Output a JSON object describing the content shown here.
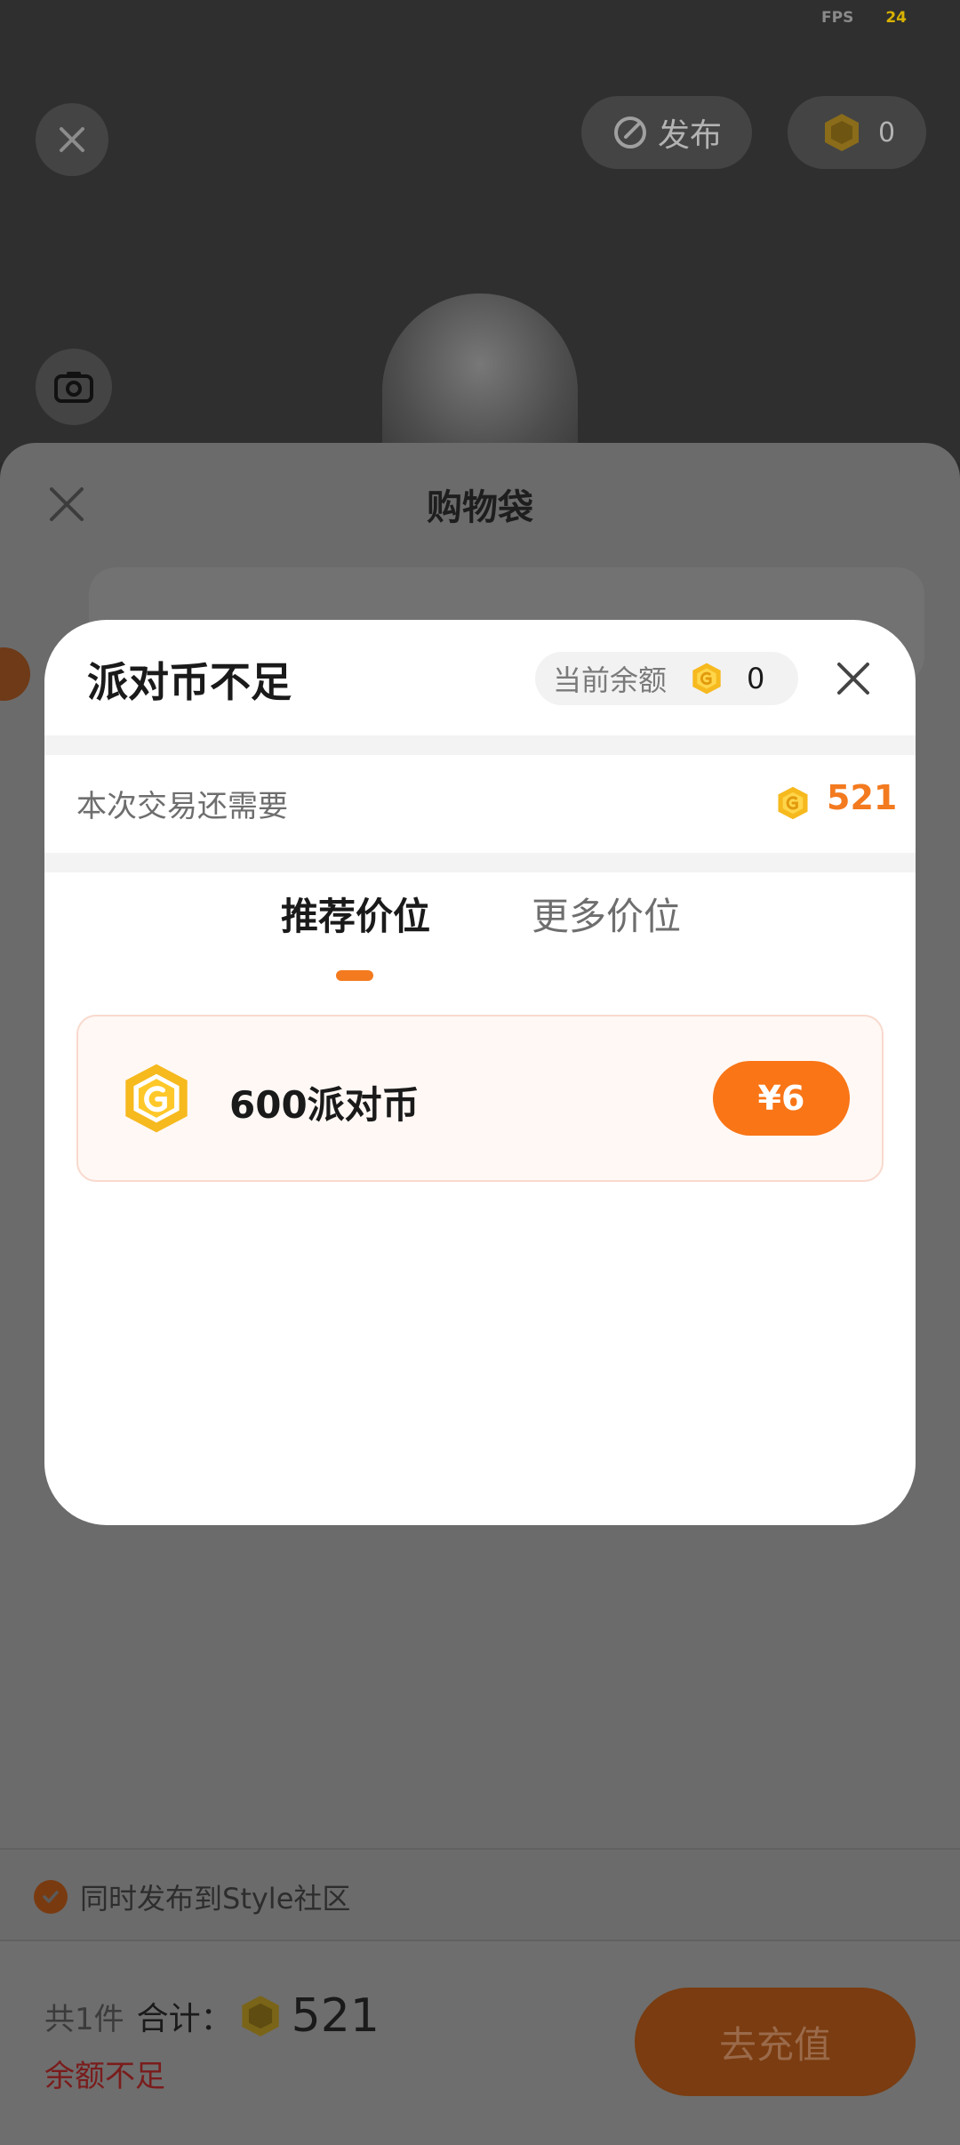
{
  "status": {
    "fps_label": "FPS",
    "fps_value": "24"
  },
  "top_bar": {
    "publish_label": "发布",
    "coin_balance": "0"
  },
  "shopping_bag": {
    "title": "购物袋",
    "community_label": "同时发布到Style社区",
    "item_count": "共1件",
    "total_label": "合计：",
    "total_value": "521",
    "insufficient_label": "余额不足",
    "recharge_label": "去充值"
  },
  "dialog": {
    "title": "派对币不足",
    "balance_label": "当前余额",
    "balance_value": "0",
    "need_label": "本次交易还需要",
    "need_value": "521",
    "tabs": [
      {
        "label": "推荐价位",
        "active": true
      },
      {
        "label": "更多价位",
        "active": false
      }
    ],
    "package": {
      "label": "600派对币",
      "price": "¥6"
    }
  },
  "colors": {
    "accent": "#f97516",
    "coin": "#f6b91e",
    "need_value": "#f37a1f"
  },
  "icons": [
    "close-icon",
    "camera-icon",
    "publish-icon",
    "coin-icon",
    "check-icon"
  ]
}
